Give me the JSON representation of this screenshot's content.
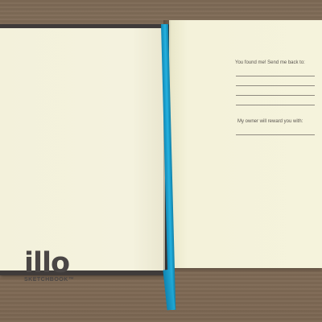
{
  "logo": {
    "word": "illo",
    "subtitle": "SKETCHBOOK™"
  },
  "right_page": {
    "return_prompt": "You found me! Send me back to:",
    "reward_prompt": "My owner will reward you with:"
  },
  "colors": {
    "table": "#86705a",
    "page": "#f4f2dc",
    "cover": "#3f3b3a",
    "ribbon": "#1fa8d8",
    "logo_text": "#4a4645"
  }
}
